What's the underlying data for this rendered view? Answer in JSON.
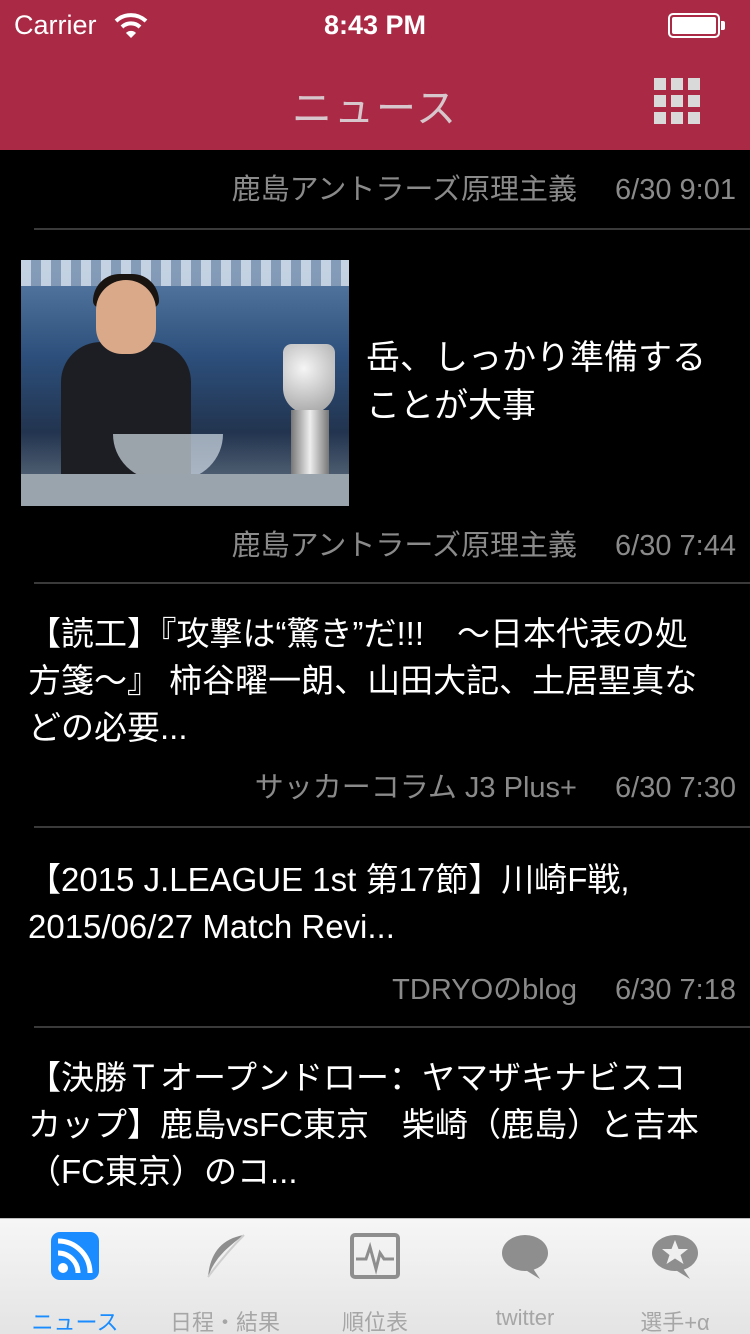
{
  "status_bar": {
    "carrier": "Carrier",
    "time": "8:43 PM"
  },
  "nav": {
    "title": "ニュース",
    "menu_icon": "grid-icon"
  },
  "feed": {
    "items": [
      {
        "headline": "",
        "source": "鹿島アントラーズ原理主義",
        "date": "6/30 9:01"
      },
      {
        "headline": "岳、しっかり準備することが大事",
        "source": "鹿島アントラーズ原理主義",
        "date": "6/30 7:44",
        "has_image": true
      },
      {
        "headline": "【読工】『攻撃は“驚き”だ!!!　～日本代表の処方箋～』 柿谷曜一朗、山田大記、土居聖真などの必要...",
        "source": "サッカーコラム J3 Plus+",
        "date": "6/30 7:30"
      },
      {
        "headline": "【2015 J.LEAGUE 1st 第17節】川崎F戦, 2015/06/27 Match Revi...",
        "source": "TDRYOのblog",
        "date": "6/30 7:18"
      },
      {
        "headline": "【決勝Ｔオープンドロー：ヤマザキナビスコカップ】鹿島vsFC東京　柴崎（鹿島）と吉本（FC東京）のコ...",
        "source": "",
        "date": ""
      }
    ]
  },
  "tabs": [
    {
      "label": "ニュース",
      "icon": "rss-icon",
      "active": true
    },
    {
      "label": "日程・結果",
      "icon": "feather-icon",
      "active": false
    },
    {
      "label": "順位表",
      "icon": "chart-icon",
      "active": false
    },
    {
      "label": "twitter",
      "icon": "speech-bubble-icon",
      "active": false
    },
    {
      "label": "選手+α",
      "icon": "star-bubble-icon",
      "active": false
    }
  ],
  "colors": {
    "brand": "#aa2a46",
    "active_tab": "#1a8cff"
  }
}
